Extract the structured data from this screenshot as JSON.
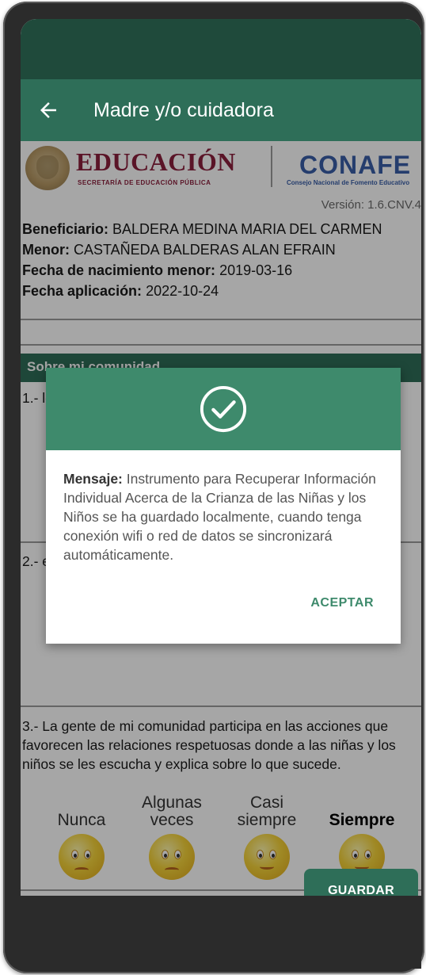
{
  "appbar": {
    "title": "Madre y/o cuidadora"
  },
  "header": {
    "edu_title": "EDUCACIÓN",
    "edu_subtitle": "SECRETARÍA DE EDUCACIÓN PÚBLICA",
    "conafe_title": "CONAFE",
    "conafe_subtitle": "Consejo Nacional de Fomento Educativo",
    "version": "Versión: 1.6.CNV.4"
  },
  "info": {
    "beneficiario_label": "Beneficiario:",
    "beneficiario_value": " BALDERA MEDINA MARIA DEL CARMEN",
    "menor_label": "Menor:",
    "menor_value": " CASTAÑEDA BALDERAS ALAN EFRAIN",
    "fecha_nac_label": "Fecha de nacimiento menor:",
    "fecha_nac_value": " 2019-03-16",
    "fecha_apl_label": "Fecha aplicación:",
    "fecha_apl_value": " 2022-10-24"
  },
  "section": {
    "title": "Sobre mi comunidad"
  },
  "questions": [
    {
      "text": "1.- los par"
    },
    {
      "text": "2.- edu peo"
    },
    {
      "text": "3.- La gente de mi comunidad participa en las acciones que favorecen las relaciones respetuosas donde a las niñas y los niños se les escucha y explica sobre lo que sucede."
    }
  ],
  "rating": {
    "options": [
      "Nunca",
      "Algunas veces",
      "Casi siempre",
      "Siempre"
    ],
    "icons": [
      "sad-thumbs-down-icon",
      "neutral-face-icon",
      "ok-hand-face-icon",
      "happy-thumbs-up-icon"
    ]
  },
  "dialog": {
    "label": "Mensaje:",
    "message": " Instrumento para Recuperar Información Individual Acerca de la Crianza de las Niñas y los Niños se ha guardado localmente, cuando tenga conexión wifi o red de datos se sincronizará automáticamente.",
    "accept_label": "ACEPTAR"
  },
  "footer": {
    "save_label": "GUARDAR"
  },
  "colors": {
    "primary": "#2e6e58",
    "dialog_header": "#3e8a6c",
    "status_bar": "#1f4a3b",
    "edu": "#8a1f3c",
    "conafe": "#3a5fa8"
  }
}
